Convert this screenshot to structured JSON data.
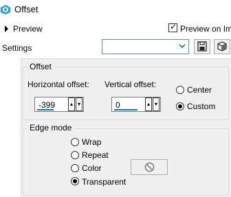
{
  "window": {
    "title": "Offset"
  },
  "preview": {
    "label": "Preview",
    "preview_on_image_label": "Preview on Ima",
    "preview_on_image_checked": true
  },
  "settings": {
    "label": "Settings",
    "selected_value": ""
  },
  "offset": {
    "title": "Offset",
    "horizontal_label": "Horizontal offset:",
    "horizontal_value": "-399",
    "vertical_label": "Vertical offset:",
    "vertical_value": "0",
    "center_label": "Center",
    "custom_label": "Custom",
    "selected": "Custom"
  },
  "edge_mode": {
    "title": "Edge mode",
    "options": [
      "Wrap",
      "Repeat",
      "Color",
      "Transparent"
    ],
    "selected": "Transparent"
  },
  "colors": {
    "accent": "#0078d7",
    "panel_bg": "#f0f0f0",
    "icon_cyan": "#1aa3d9"
  }
}
